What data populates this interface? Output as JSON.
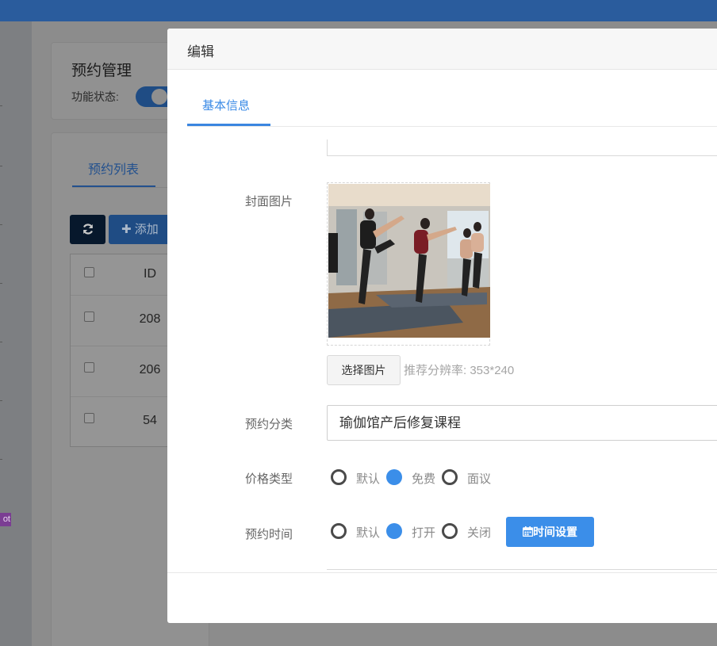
{
  "background_page": {
    "card_title": "预约管理",
    "status_label": "功能状态:",
    "status_on": true,
    "tab_label": "预约列表",
    "refresh_icon": "refresh-icon",
    "add_button": "✚ 添加",
    "table": {
      "header": "ID",
      "rows": [
        "208",
        "206",
        "54"
      ]
    },
    "side_badge": "ot"
  },
  "modal": {
    "title": "编辑",
    "tab": "基本信息",
    "cover_label": "封面图片",
    "cover_image_alt": "yoga-class-photo",
    "pick_button": "选择图片",
    "recommend_text": "推荐分辨率: 353*240",
    "category_label": "预约分类",
    "category_value": "瑜伽馆产后修复课程",
    "price_label": "价格类型",
    "price_options": [
      "默认",
      "免费",
      "面议"
    ],
    "price_selected": "免费",
    "time_label": "预约时间",
    "time_options": [
      "默认",
      "打开",
      "关闭"
    ],
    "time_selected": "打开",
    "time_button": "时间设置",
    "time_button_icon": "calendar-icon"
  },
  "colors": {
    "accent": "#3b8ee9",
    "topbar": "#2a5c9d"
  }
}
